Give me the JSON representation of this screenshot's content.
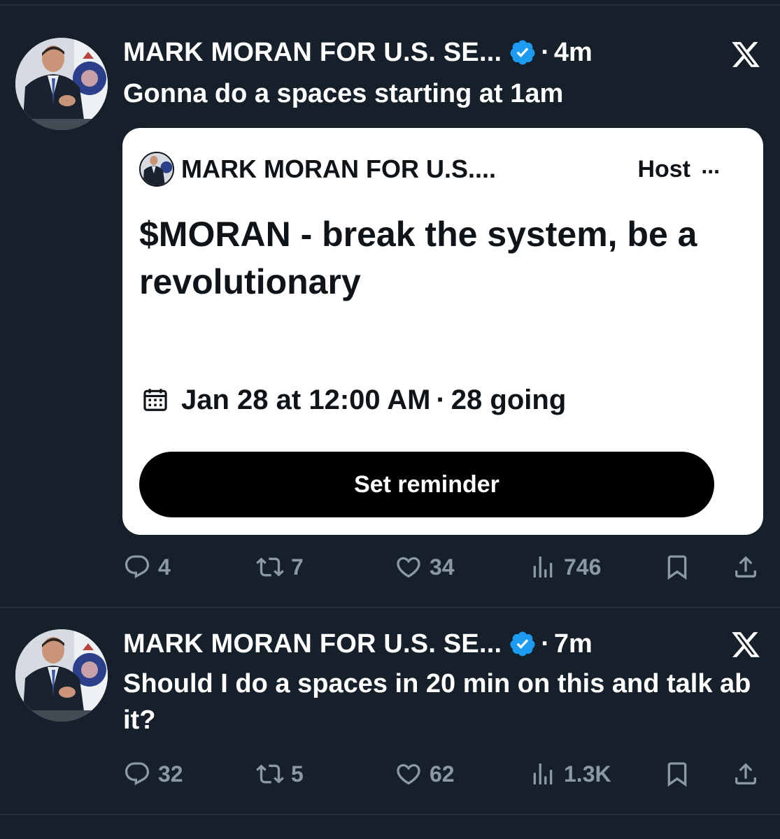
{
  "tweets": [
    {
      "author": "MARK MORAN FOR U.S. SE...",
      "separator": "·",
      "time": "4m",
      "text": "Gonna do a spaces starting at 1am",
      "space": {
        "host_name": "MARK MORAN FOR U.S....",
        "host_label": "Host",
        "more": "...",
        "title": "$MORAN - break the system, be a revolutionary",
        "date": "Jan 28 at 12:00 AM",
        "separator": "·",
        "going": "28 going",
        "button": "Set reminder"
      },
      "replies": "4",
      "reposts": "7",
      "likes": "34",
      "views": "746"
    },
    {
      "author": "MARK MORAN FOR U.S. SE...",
      "separator": "·",
      "time": "7m",
      "text": "Should I do a spaces in 20 min on this and talk ab it?",
      "replies": "32",
      "reposts": "5",
      "likes": "62",
      "views": "1.3K"
    }
  ],
  "colors": {
    "background": "#15202b",
    "verified": "#1d9bf0",
    "muted": "#8b98a5",
    "card": "#ffffff",
    "button": "#000000"
  },
  "icons": [
    "verified-badge-icon",
    "x-logo-icon",
    "calendar-icon",
    "reply-icon",
    "repost-icon",
    "like-icon",
    "views-icon",
    "bookmark-icon",
    "share-icon"
  ]
}
